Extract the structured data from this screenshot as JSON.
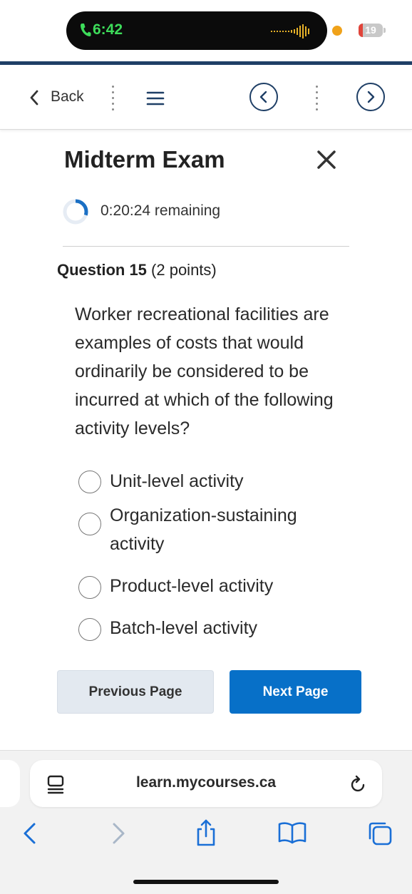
{
  "status_bar": {
    "time": "6:42",
    "battery_level": "19",
    "battery_color": "#e0443a",
    "call_indicator_color": "#3ddc5a",
    "icons": [
      "phone-icon",
      "audio-waveform-icon",
      "orange-dot-icon",
      "battery-icon"
    ]
  },
  "toolbar": {
    "back_label": "Back",
    "icons": [
      "chevron-left-icon",
      "menu-icon",
      "previous-question-icon",
      "next-question-icon"
    ]
  },
  "exam": {
    "title": "Midterm Exam",
    "close_icon": "close-icon",
    "timer_text": "0:20:24 remaining",
    "timer_fraction_remaining": 0.3
  },
  "question": {
    "number_label": "Question 15",
    "points_label": " (2 points)",
    "text": "Worker recreational facilities are examples of costs that would ordinarily be considered to be incurred at which of the following activity levels?",
    "options": [
      "Unit-level activity",
      "Organization-sustaining activity",
      "Product-level activity",
      "Batch-level activity"
    ]
  },
  "navigation": {
    "previous_label": "Previous Page",
    "next_label": "Next Page",
    "accent_color": "#0770c8"
  },
  "browser": {
    "url": "learn.mycourses.ca",
    "icons": [
      "tab-overview-icon",
      "reload-icon",
      "back-arrow-icon",
      "forward-arrow-icon",
      "share-icon",
      "bookmarks-icon",
      "tabs-icon"
    ]
  }
}
